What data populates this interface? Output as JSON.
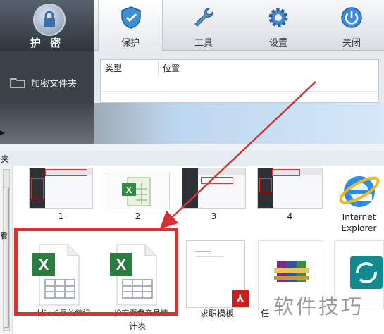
{
  "app": {
    "brand_label": "护 密",
    "toolbar": [
      {
        "label": "保护",
        "icon": "shield-icon",
        "active": true
      },
      {
        "label": "工具",
        "icon": "wrench-icon",
        "active": false
      },
      {
        "label": "设置",
        "icon": "gear-icon",
        "active": false
      },
      {
        "label": "关闭",
        "icon": "power-icon",
        "active": false
      }
    ],
    "sidebar_item": "加密文件夹",
    "table_headers": [
      "类型",
      "位置"
    ]
  },
  "explorer": {
    "bar_text": "夹",
    "side_glyph": "看",
    "row1": [
      {
        "label": "1",
        "kind": "screenshot"
      },
      {
        "label": "2",
        "kind": "excel"
      },
      {
        "label": "3",
        "kind": "screenshot"
      },
      {
        "label": "4",
        "kind": "screenshot"
      },
      {
        "label": "Internet Explorer",
        "line1": "Internet",
        "line2": "Explorer",
        "kind": "ie"
      }
    ],
    "row2": [
      {
        "label": "村冲长星关绩记",
        "kind": "excel-doc"
      },
      {
        "label": "护安面盘产品绩",
        "line2": "计表",
        "kind": "excel-doc"
      },
      {
        "label": "求职模板",
        "kind": "pdf"
      },
      {
        "label": "任",
        "kind": "rar"
      },
      {
        "label": "",
        "kind": "media"
      }
    ]
  },
  "annotation": {
    "highlight_color": "#e02f2f",
    "arrow_color": "#d33232"
  },
  "watermark": "软件技巧"
}
